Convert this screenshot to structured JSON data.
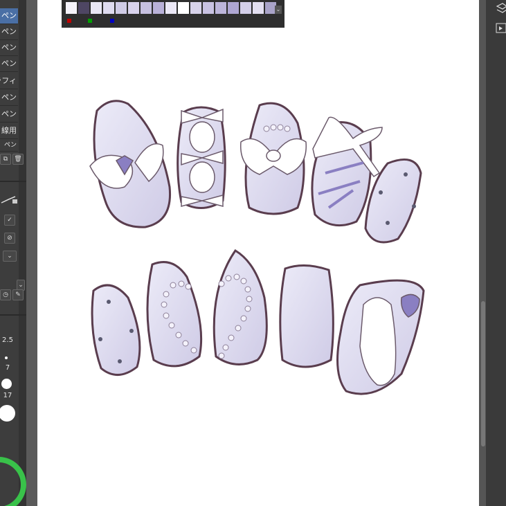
{
  "tool_panel": {
    "subtools": [
      "ペン",
      "ペン",
      "ペン",
      "ペン",
      "ラフィ",
      "ペン",
      "ペン",
      "線用",
      "ペン"
    ],
    "selected_index": 0,
    "brush_sizes": [
      "2.5",
      "7",
      "17"
    ]
  },
  "palette": {
    "swatches": [
      "#f5f3fa",
      "#4e4663",
      "#e9e7f4",
      "#dedbef",
      "#cfcbe6",
      "#d8d2ec",
      "#c6c0e0",
      "#b9b1d8",
      "#ebe8f6",
      "#ffffff",
      "#d7d2ea",
      "#c8c2e2",
      "#bcb5da",
      "#aea6d2",
      "#d3cee8",
      "#e3dff1",
      "#a9a3c8"
    ],
    "markers": [
      "#c00000",
      "#00a000",
      "#0000c0"
    ]
  },
  "colors": {
    "outline": "#5a3d4e",
    "nail_fill": "#e4e2f3",
    "nail_shade": "#cfcbe6",
    "accent": "#8a7fc2",
    "ring": "#39c24a"
  }
}
